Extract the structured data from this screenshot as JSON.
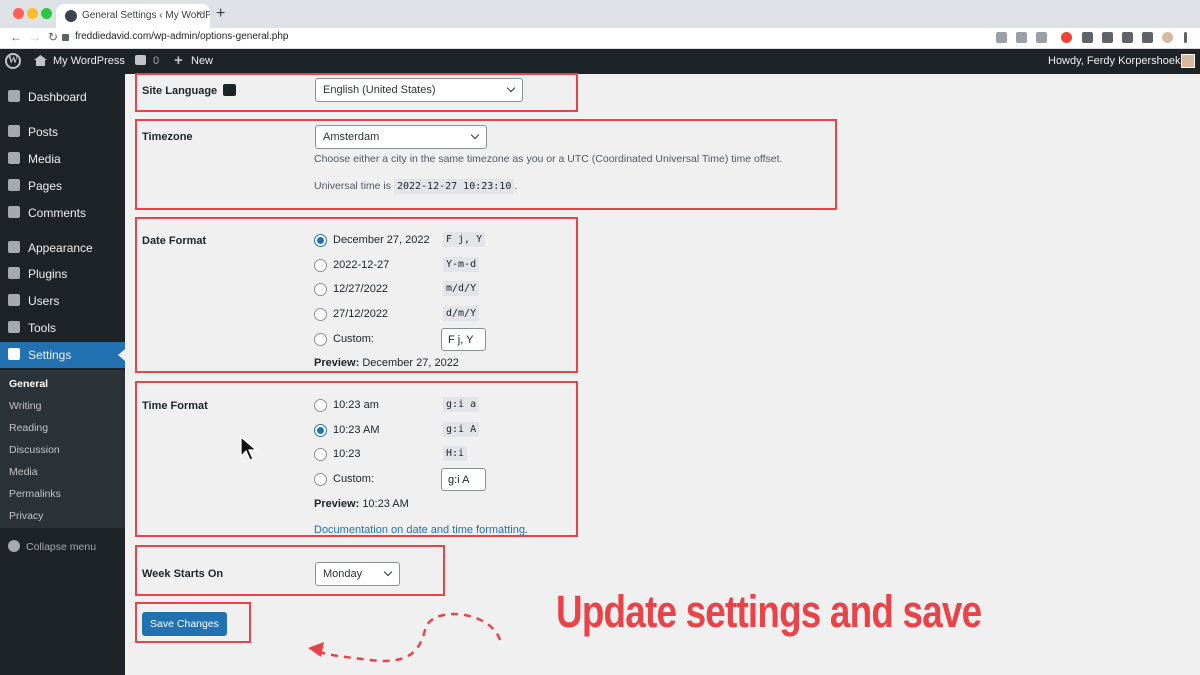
{
  "browser": {
    "tab_title": "General Settings ‹ My WordPress",
    "tab_close": "×",
    "new_tab": "+",
    "url": "freddiedavid.com/wp-admin/options-general.php",
    "back": "←",
    "forward": "→",
    "reload": "↻"
  },
  "adminbar": {
    "site_name": "My WordPress",
    "comments_count": "0",
    "new_label": "New",
    "howdy": "Howdy, Ferdy Korpershoek"
  },
  "sidebar": {
    "items": [
      {
        "label": "Dashboard",
        "icon": "dashboard-icon"
      },
      {
        "label": "Posts",
        "icon": "pin-icon"
      },
      {
        "label": "Media",
        "icon": "media-icon"
      },
      {
        "label": "Pages",
        "icon": "pages-icon"
      },
      {
        "label": "Comments",
        "icon": "comment-icon"
      },
      {
        "label": "Appearance",
        "icon": "brush-icon"
      },
      {
        "label": "Plugins",
        "icon": "plug-icon"
      },
      {
        "label": "Users",
        "icon": "user-icon"
      },
      {
        "label": "Tools",
        "icon": "wrench-icon"
      },
      {
        "label": "Settings",
        "icon": "settings-icon"
      }
    ],
    "submenu": [
      "General",
      "Writing",
      "Reading",
      "Discussion",
      "Media",
      "Permalinks",
      "Privacy"
    ],
    "collapse_label": "Collapse menu"
  },
  "settings": {
    "site_language": {
      "label": "Site Language",
      "value": "English (United States)"
    },
    "timezone": {
      "label": "Timezone",
      "value": "Amsterdam",
      "description": "Choose either a city in the same timezone as you or a UTC (Coordinated Universal Time) time offset.",
      "universal_prefix": "Universal time is",
      "universal_time": "2022-12-27 10:23:10",
      "universal_suffix": "."
    },
    "date_format": {
      "label": "Date Format",
      "options": [
        {
          "label": "December 27, 2022",
          "code": "F j, Y",
          "checked": true
        },
        {
          "label": "2022-12-27",
          "code": "Y-m-d",
          "checked": false
        },
        {
          "label": "12/27/2022",
          "code": "m/d/Y",
          "checked": false
        },
        {
          "label": "27/12/2022",
          "code": "d/m/Y",
          "checked": false
        }
      ],
      "custom_label": "Custom:",
      "custom_value": "F j, Y",
      "preview_label": "Preview:",
      "preview_value": "December 27, 2022"
    },
    "time_format": {
      "label": "Time Format",
      "options": [
        {
          "label": "10:23 am",
          "code": "g:i a",
          "checked": false
        },
        {
          "label": "10:23 AM",
          "code": "g:i A",
          "checked": true
        },
        {
          "label": "10:23",
          "code": "H:i",
          "checked": false
        }
      ],
      "custom_label": "Custom:",
      "custom_value": "g:i A",
      "preview_label": "Preview:",
      "preview_value": "10:23 AM",
      "doc_link": "Documentation on date and time formatting."
    },
    "week_starts_on": {
      "label": "Week Starts On",
      "value": "Monday"
    },
    "save_button": "Save Changes"
  },
  "annotation": {
    "text": "Update settings and save",
    "color": "#e9434a"
  },
  "colors": {
    "wp_blue": "#2271b1",
    "admin_dark": "#1d2327",
    "annotation_red": "#e9434a"
  }
}
